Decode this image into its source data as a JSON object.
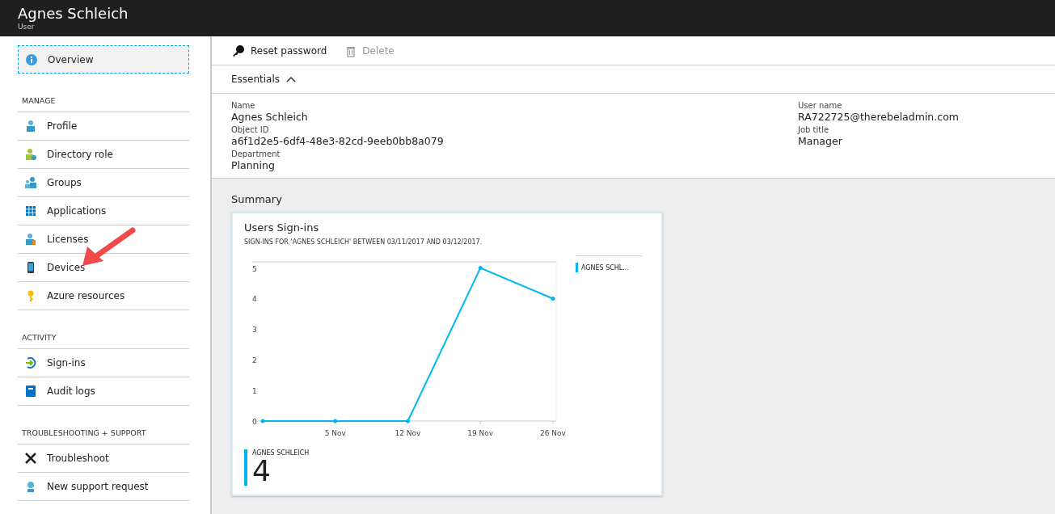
{
  "header": {
    "title": "Agnes Schleich",
    "subtitle": "User"
  },
  "sidebar": {
    "items": [
      {
        "label": "Overview",
        "selected": true
      }
    ],
    "sections": [
      {
        "title": "MANAGE",
        "items": [
          {
            "label": "Profile",
            "selected": false
          },
          {
            "label": "Directory role",
            "selected": false
          },
          {
            "label": "Groups",
            "selected": false
          },
          {
            "label": "Applications",
            "selected": false
          },
          {
            "label": "Licenses",
            "selected": false
          },
          {
            "label": "Devices",
            "selected": false
          },
          {
            "label": "Azure resources",
            "selected": false
          }
        ]
      },
      {
        "title": "ACTIVITY",
        "items": [
          {
            "label": "Sign-ins",
            "selected": false
          },
          {
            "label": "Audit logs",
            "selected": false
          }
        ]
      },
      {
        "title": "TROUBLESHOOTING + SUPPORT",
        "items": [
          {
            "label": "Troubleshoot",
            "selected": false
          },
          {
            "label": "New support request",
            "selected": false
          }
        ]
      }
    ]
  },
  "toolbar": [
    {
      "label": "Reset password",
      "disabled": false
    },
    {
      "label": "Delete",
      "disabled": true
    }
  ],
  "essentials": {
    "title": "Essentials",
    "expanded": true,
    "left": [
      {
        "label": "Name",
        "value": "Agnes Schleich"
      },
      {
        "label": "Object ID",
        "value": "a6f1d2e5-6df4-48e3-82cd-9eeb0bb8a079"
      },
      {
        "label": "Department",
        "value": "Planning"
      }
    ],
    "right": [
      {
        "label": "User name",
        "value": "RA722725@therebeladmin.com"
      },
      {
        "label": "Job title",
        "value": "Manager"
      }
    ]
  },
  "summary": {
    "title": "Summary",
    "tile": {
      "title": "Users Sign-ins",
      "subtitle": "SIGN-INS FOR 'AGNES SCHLEICH' BETWEEN 03/11/2017 AND 03/12/2017.",
      "total_label": "AGNES SCHLEICH",
      "total": "4",
      "chart_data": {
        "type": "line",
        "categories": [
          null,
          "5 Nov",
          "12 Nov",
          "19 Nov",
          "26 Nov"
        ],
        "ylim": [
          0,
          5.2
        ],
        "yticks": [
          0,
          1,
          2,
          3,
          4,
          5
        ],
        "series": [
          {
            "name": "AGNES SCHL...",
            "color": "#00b7f0",
            "values": [
              0,
              0,
              0,
              5,
              4
            ]
          }
        ]
      }
    }
  }
}
